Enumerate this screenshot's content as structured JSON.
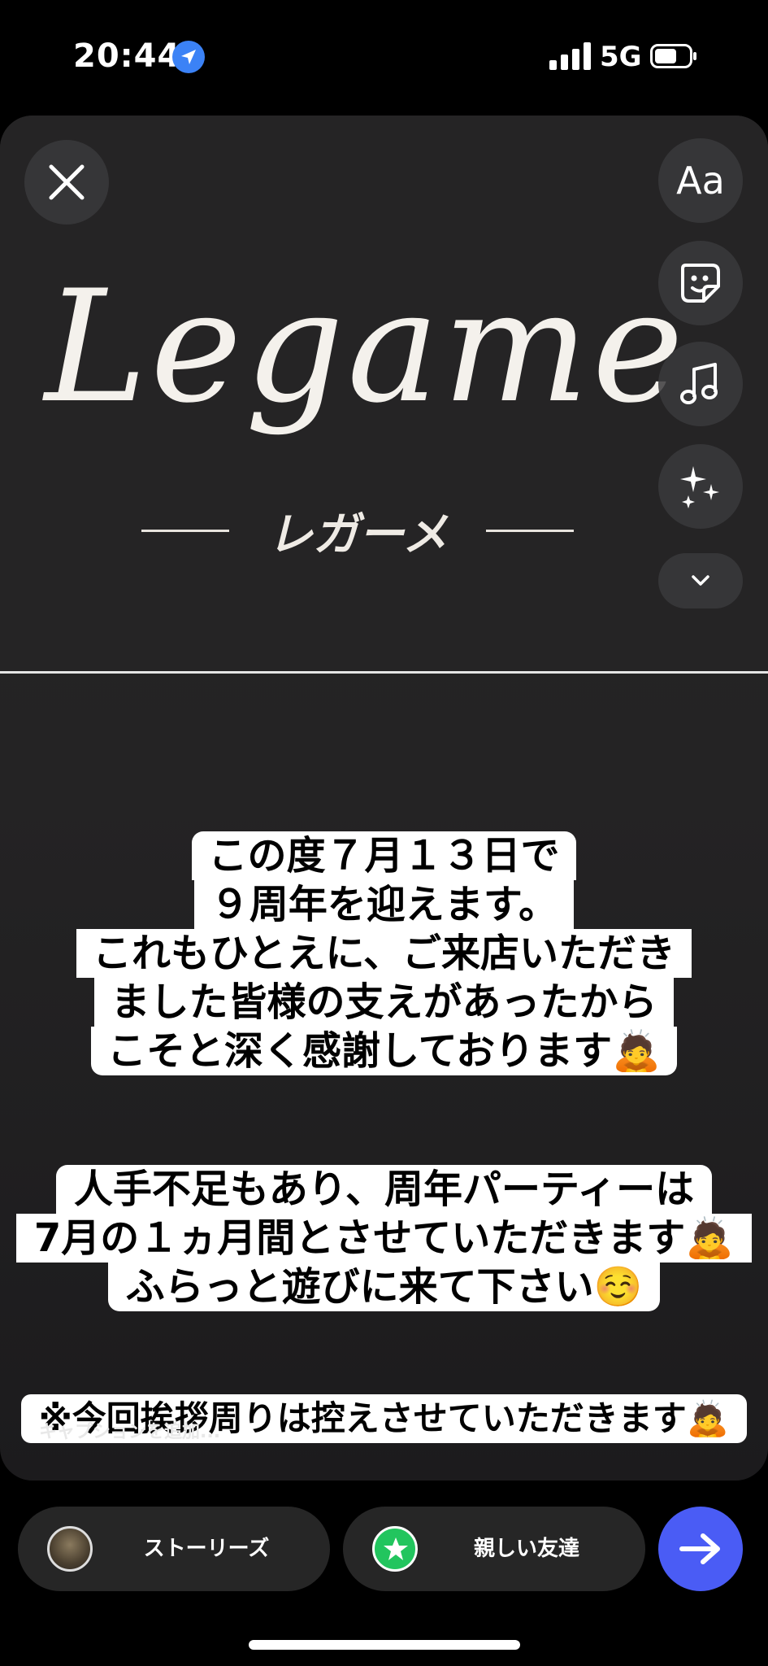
{
  "status_bar": {
    "time": "20:44",
    "network": "5G"
  },
  "story": {
    "logo": {
      "name": "Legame",
      "kana": "レガーメ"
    },
    "toolbar": {
      "text_tool_label": "Aa"
    },
    "block1": {
      "lines": [
        "この度７月１３日で",
        "９周年を迎えます。",
        "これもひとえに、ご来店いただき",
        "ました皆様の支えがあったから",
        "こそと深く感謝しております🙇"
      ]
    },
    "block2": {
      "lines": [
        "人手不足もあり、周年パーティーは",
        "7月の１ヵ月間とさせていただきます🙇",
        "ふらっと遊びに来て下さい☺️"
      ]
    },
    "block3": {
      "lines": [
        "※今回挨拶周りは控えさせていただきます🙇"
      ]
    },
    "caption_placeholder": "キャプションを追加..."
  },
  "share": {
    "stories_label": "ストーリーズ",
    "close_friends_label": "親しい友達"
  },
  "colors": {
    "send_button": "#4a5cf5",
    "close_friends_badge": "#22c55e"
  }
}
